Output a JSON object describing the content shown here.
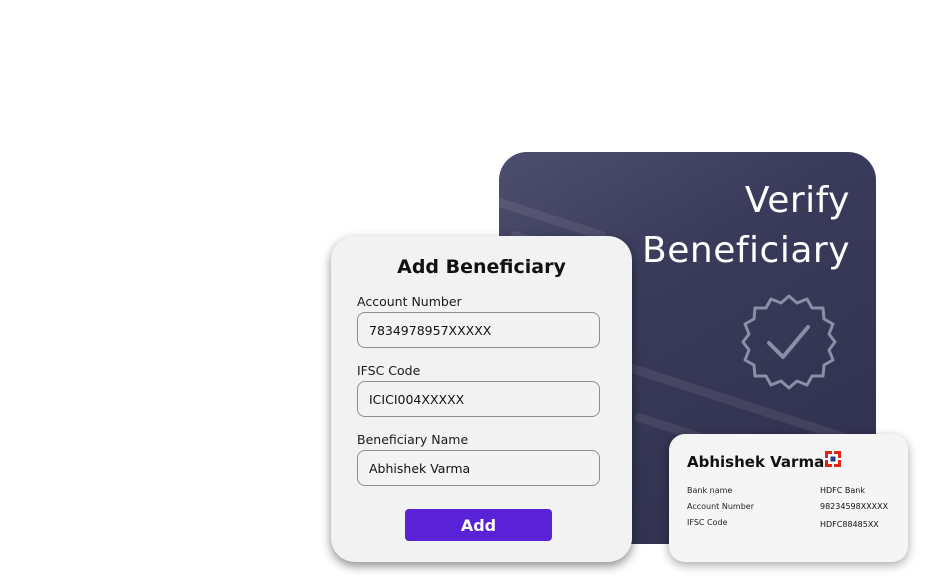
{
  "verify": {
    "title_line1": "Verify",
    "title_line2": "Beneficiary",
    "badge_icon": "verified-check-badge-icon"
  },
  "form": {
    "title": "Add Beneficiary",
    "fields": [
      {
        "label": "Account Number",
        "value": "7834978957XXXXX"
      },
      {
        "label": "IFSC Code",
        "value": "ICICI004XXXXX"
      },
      {
        "label": "Beneficiary Name",
        "value": "Abhishek Varma"
      }
    ],
    "submit_label": "Add"
  },
  "summary": {
    "name": "Abhishek Varma",
    "logo_icon": "hdfc-bank-logo-icon",
    "rows": [
      {
        "label": "Bank name",
        "value": "HDFC Bank"
      },
      {
        "label": "Account Number",
        "value": "98234598XXXXX"
      },
      {
        "label": "IFSC Code",
        "value": "HDFC88485XX"
      }
    ]
  },
  "colors": {
    "accent": "#5a22d6",
    "verify_card": "#34354f",
    "card_background": "#f2f2f2",
    "bank_logo_red": "#e2231a",
    "bank_logo_blue": "#1f3f8f"
  }
}
